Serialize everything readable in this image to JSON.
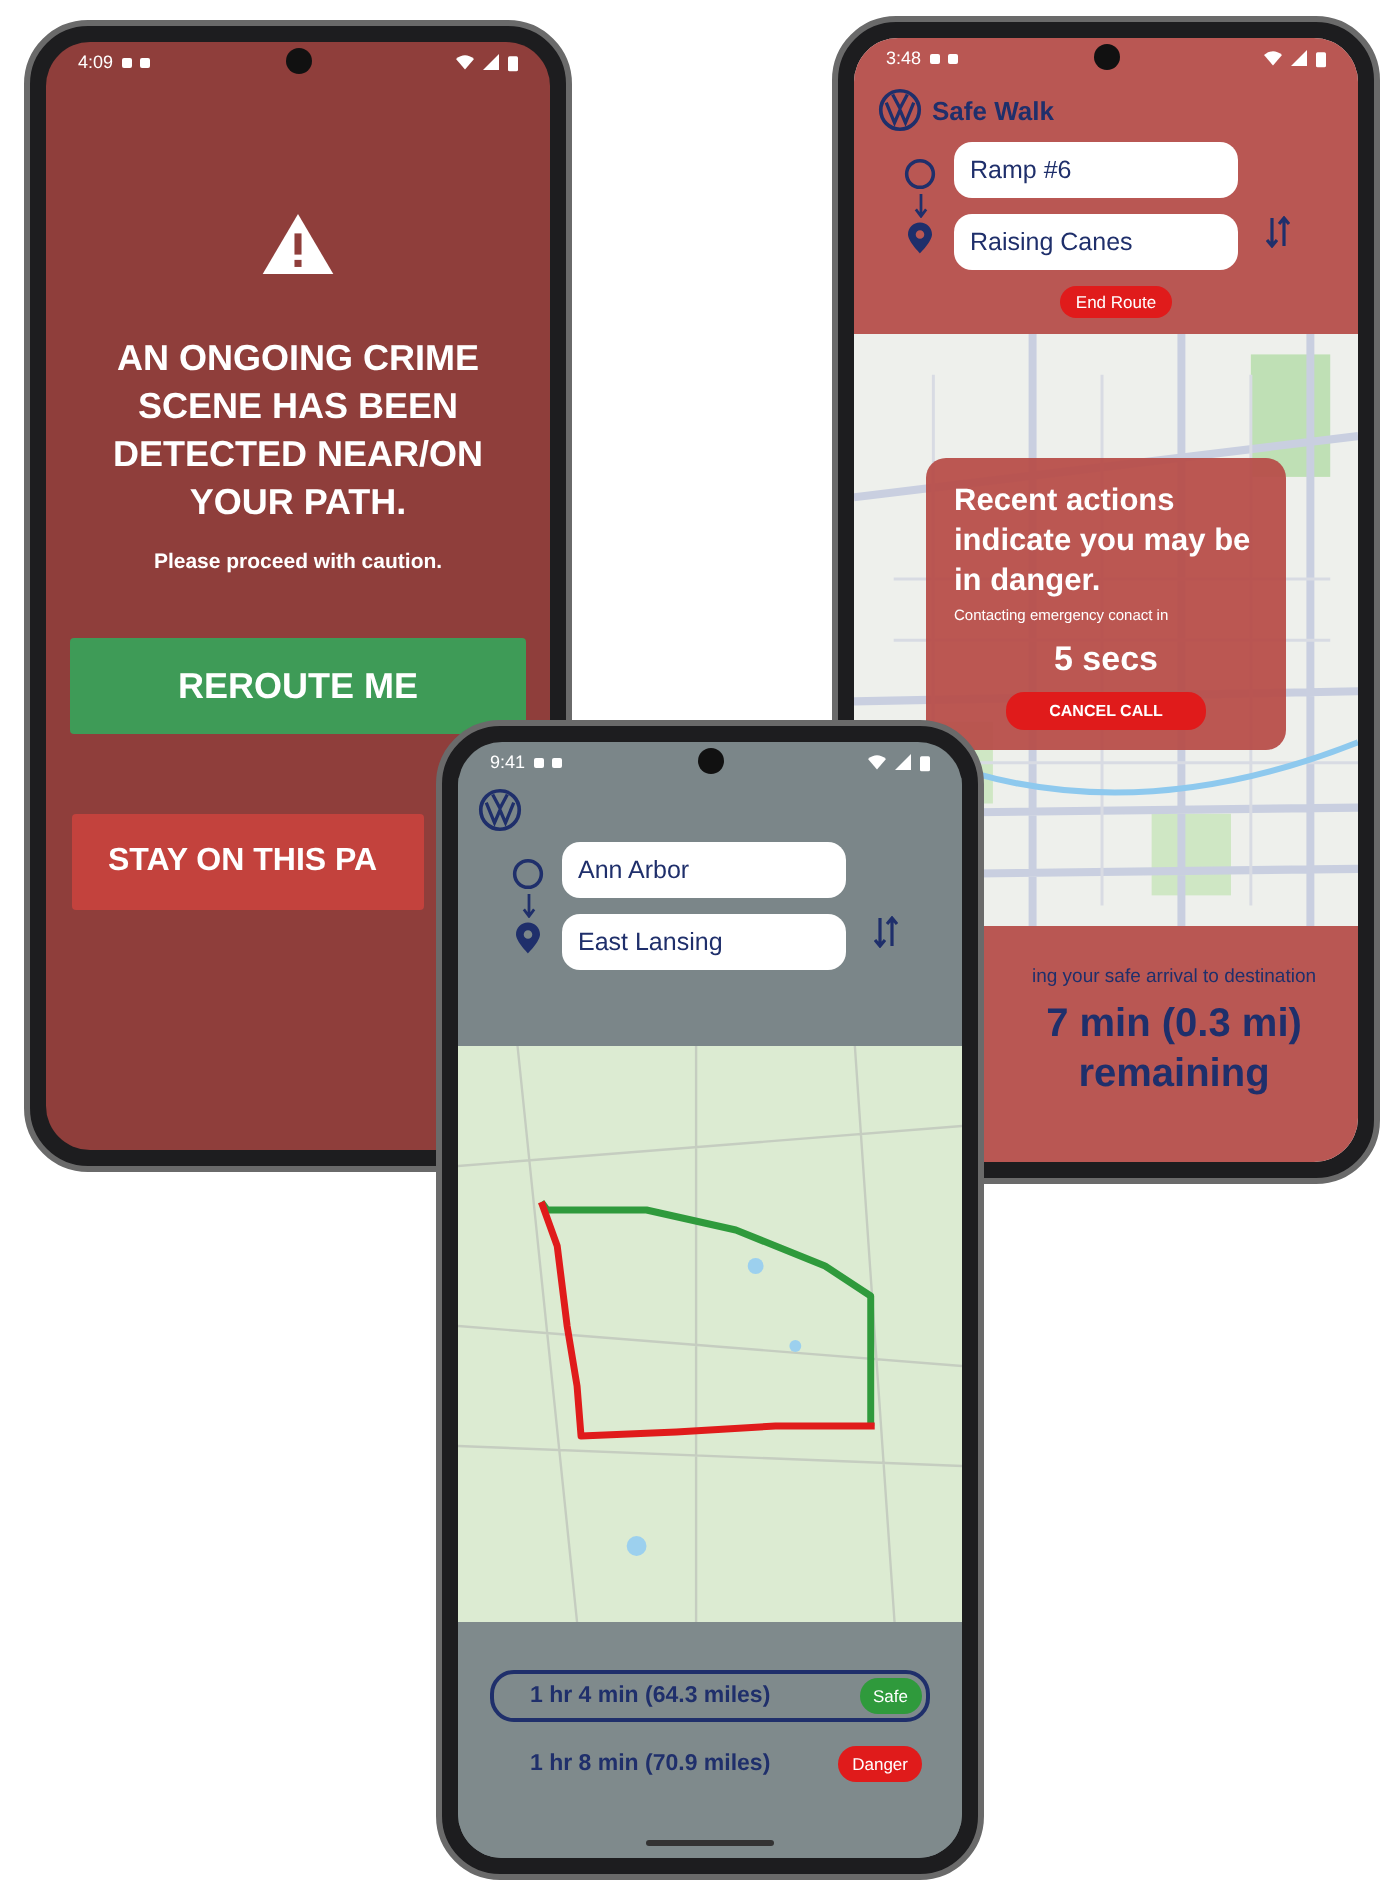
{
  "alert_screen": {
    "status_bar": {
      "time": "4:09"
    },
    "message": "AN ONGOING CRIME SCENE HAS BEEN DETECTED NEAR/ON YOUR PATH.",
    "subtext": "Please proceed with caution.",
    "buttons": [
      {
        "label": "REROUTE ME",
        "color": "#3e9b57"
      },
      {
        "label": "STAY ON THIS PA",
        "color": "#c3423d"
      }
    ]
  },
  "danger_screen": {
    "status_bar": {
      "time": "3:48"
    },
    "app_title": "Safe Walk",
    "origin": "Ramp #6",
    "destination": "Raising Canes",
    "end_button": "End Route",
    "popup": {
      "title": "Recent actions indicate you may be in danger.",
      "subtitle": "Contacting emergency conact in",
      "countdown": "5 secs",
      "button": "CANCEL CALL"
    },
    "tracking": {
      "caption": "ing your safe arrival to destination",
      "remaining": "7 min (0.3 mi) remaining"
    }
  },
  "route_screen": {
    "status_bar": {
      "time": "9:41"
    },
    "origin": "Ann Arbor",
    "destination": "East Lansing",
    "routes": [
      {
        "summary": "1 hr 4 min (64.3 miles)",
        "selected": true,
        "tag": "Safe",
        "color": "#2f9a3c"
      },
      {
        "summary": "1 hr 8 min (70.9 miles)",
        "selected": false,
        "tag": "Danger",
        "color": "#e01b1b"
      }
    ]
  }
}
